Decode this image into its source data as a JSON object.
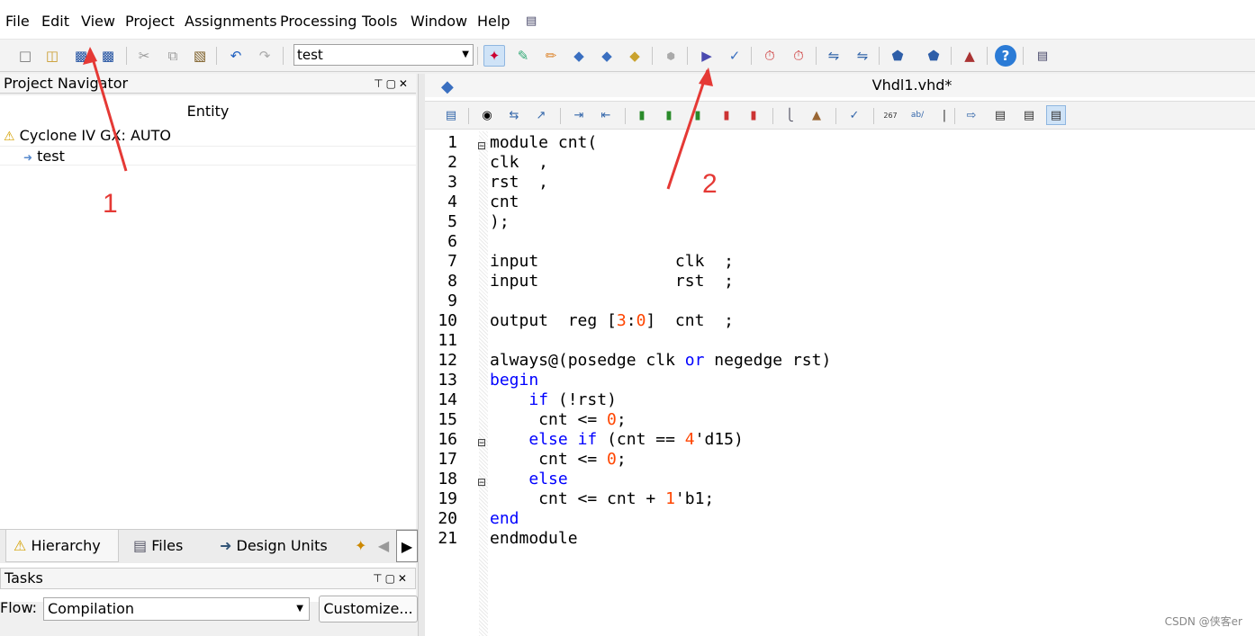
{
  "menu": [
    "File",
    "Edit",
    "View",
    "Project",
    "Assignments",
    "Processing",
    "Tools",
    "Window",
    "Help"
  ],
  "toolbar": {
    "entity_select": "test",
    "icons": [
      "new-file-icon",
      "open-icon",
      "save-icon",
      "save-all-icon",
      "cut-icon",
      "copy-icon",
      "paste-icon",
      "undo-icon",
      "redo-icon"
    ]
  },
  "navigator": {
    "title": "Project Navigator",
    "entity_header": "Entity",
    "device": "Cyclone IV GX: AUTO",
    "top_entity": "test"
  },
  "nav_tabs": [
    "Hierarchy",
    "Files",
    "Design Units"
  ],
  "tasks": {
    "title": "Tasks",
    "flow_label": "Flow:",
    "flow_value": "Compilation",
    "customize_label": "Customize..."
  },
  "editor": {
    "title": "Vhdl1.vhd*",
    "lines": [
      {
        "n": "1",
        "t": "module cnt("
      },
      {
        "n": "2",
        "t": "clk  ,"
      },
      {
        "n": "3",
        "t": "rst  ,"
      },
      {
        "n": "4",
        "t": "cnt"
      },
      {
        "n": "5",
        "t": ");"
      },
      {
        "n": "6",
        "t": ""
      },
      {
        "n": "7",
        "t": "input              clk  ;"
      },
      {
        "n": "8",
        "t": "input              rst  ;"
      },
      {
        "n": "9",
        "t": ""
      },
      {
        "n": "10",
        "t": "output  reg [3:0]  cnt  ;"
      },
      {
        "n": "11",
        "t": ""
      },
      {
        "n": "12",
        "t": "always@(posedge clk or negedge rst)"
      },
      {
        "n": "13",
        "t": "begin"
      },
      {
        "n": "14",
        "t": "    if (!rst)"
      },
      {
        "n": "15",
        "t": "     cnt <= 0;"
      },
      {
        "n": "16",
        "t": "    else if (cnt == 4'd15)"
      },
      {
        "n": "17",
        "t": "     cnt <= 0;"
      },
      {
        "n": "18",
        "t": "    else"
      },
      {
        "n": "19",
        "t": "     cnt <= cnt + 1'b1;"
      },
      {
        "n": "20",
        "t": "end"
      },
      {
        "n": "21",
        "t": "endmodule"
      }
    ]
  },
  "annotations": [
    "1",
    "2"
  ],
  "watermark": "CSDN @侠客er",
  "colors": {
    "keyword": "#0000ff",
    "number": "#ff4500",
    "annotation": "#e53935"
  }
}
